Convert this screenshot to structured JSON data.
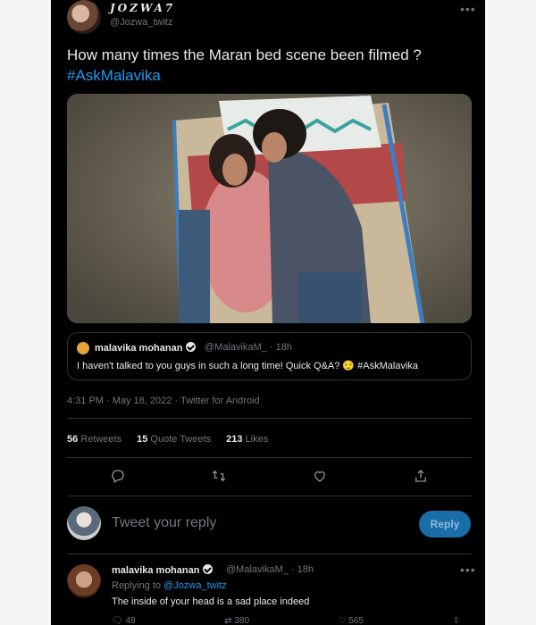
{
  "tweet": {
    "author_name": "JOZWA7",
    "author_handle": "@Jozwa_twitz",
    "more_label": "•••",
    "text": "How many times  the Maran bed scene been filmed ?",
    "hashtag": "#AskMalavika",
    "timestamp": "4:31 PM · May 18, 2022 · Twitter for Android"
  },
  "quote": {
    "name": "malavika mohanan",
    "handle": "@MalavikaM_ · 18h",
    "text": "I haven't talked to you guys in such a long time! Quick Q&A? 😌 #AskMalavika"
  },
  "stats": {
    "retweets_count": "56",
    "retweets_label": "Retweets",
    "quotes_count": "15",
    "quotes_label": "Quote Tweets",
    "likes_count": "213",
    "likes_label": "Likes"
  },
  "icons": [
    "reply-icon",
    "retweet-icon",
    "like-icon",
    "share-icon"
  ],
  "compose": {
    "placeholder": "Tweet your reply",
    "button_label": "Reply"
  },
  "reply": {
    "name": "malavika mohanan",
    "handle": "@MalavikaM_ · 18h",
    "replying_prefix": "Replying to",
    "mention": "@Jozwa_twitz",
    "text": "The inside of your head is a sad place indeed",
    "reply_count": "48",
    "retweet_count": "380",
    "like_count": "565"
  },
  "colors": {
    "accent": "#1d9bf0",
    "background": "#000000",
    "muted": "#71767b"
  }
}
